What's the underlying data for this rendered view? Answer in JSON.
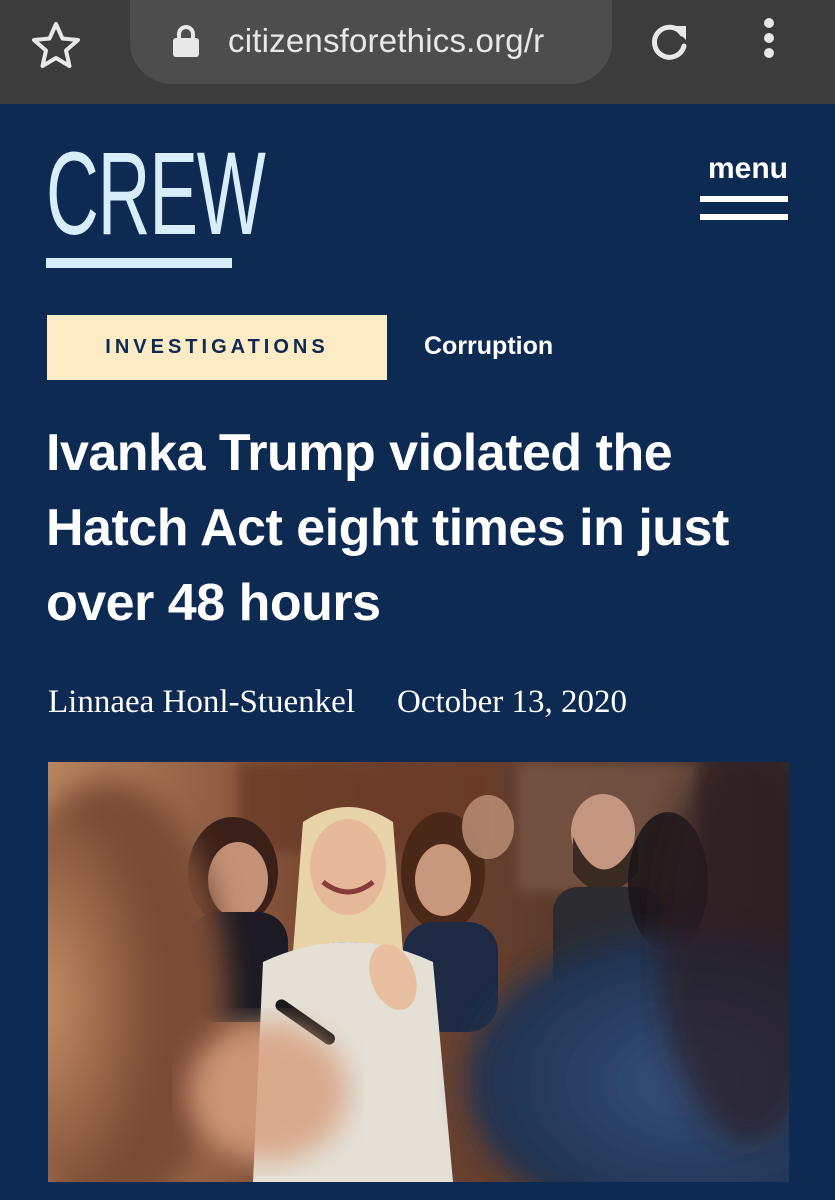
{
  "browser": {
    "url": "citizensforethics.org/r",
    "icons": {
      "bookmark": "star-icon",
      "security": "lock-icon",
      "reload": "reload-icon",
      "more": "more-vert-icon"
    }
  },
  "site": {
    "logo_text": "CREW",
    "menu_label": "menu",
    "colors": {
      "background": "#0d2a52",
      "logo": "#d7eefa",
      "tag_background": "#fcebc4",
      "text": "#ffffff"
    }
  },
  "article": {
    "tags": [
      "INVESTIGATIONS",
      "Corruption"
    ],
    "headline": "Ivanka Trump violated the Hatch Act eight times in just over 48 hours",
    "author": "Linnaea Honl-Stuenkel",
    "date": "October 13, 2020"
  }
}
